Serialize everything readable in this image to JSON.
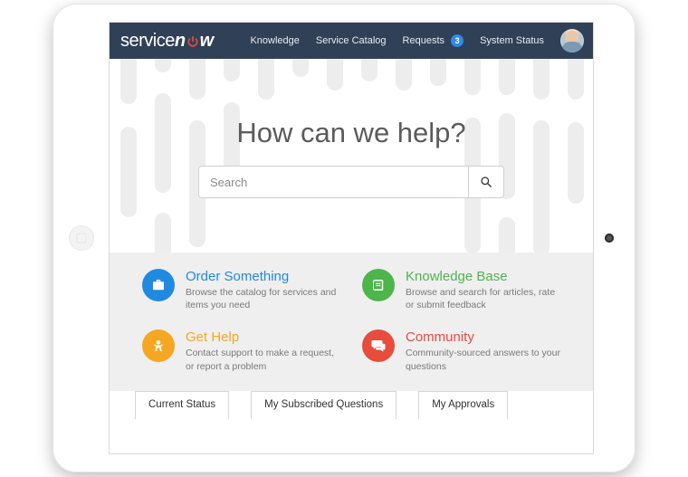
{
  "brand": {
    "part1": "service",
    "part2": "n",
    "part3": "w"
  },
  "nav": {
    "knowledge": "Knowledge",
    "catalog": "Service Catalog",
    "requests": "Requests",
    "requests_count": "3",
    "status": "System Status"
  },
  "hero": {
    "title": "How can we help?",
    "search_placeholder": "Search"
  },
  "cards": {
    "order": {
      "title": "Order Something",
      "desc": "Browse the catalog for services and items you need"
    },
    "kb": {
      "title": "Knowledge Base",
      "desc": "Browse and search for articles, rate or submit feedback"
    },
    "help": {
      "title": "Get Help",
      "desc": "Contact support to make a request, or report a problem"
    },
    "community": {
      "title": "Community",
      "desc": "Community-sourced answers to your questions"
    }
  },
  "tabs": {
    "current": "Current Status",
    "subscribed": "My Subscribed Questions",
    "approvals": "My Approvals"
  }
}
